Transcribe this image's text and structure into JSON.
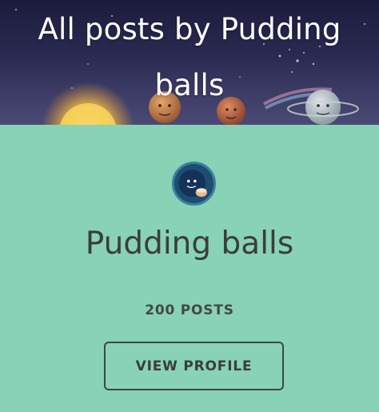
{
  "header": {
    "title": "All posts by Pudding balls"
  },
  "profile": {
    "name": "Pudding balls",
    "post_count_label": "200 POSTS",
    "view_profile_label": "VIEW PROFILE",
    "avatar_icon": "avatar-planet-icon"
  },
  "colors": {
    "card_background": "#88d2b5",
    "banner_background": "#2a2a52",
    "text_dark": "#3a3d3c",
    "title_text": "#ffffff"
  }
}
